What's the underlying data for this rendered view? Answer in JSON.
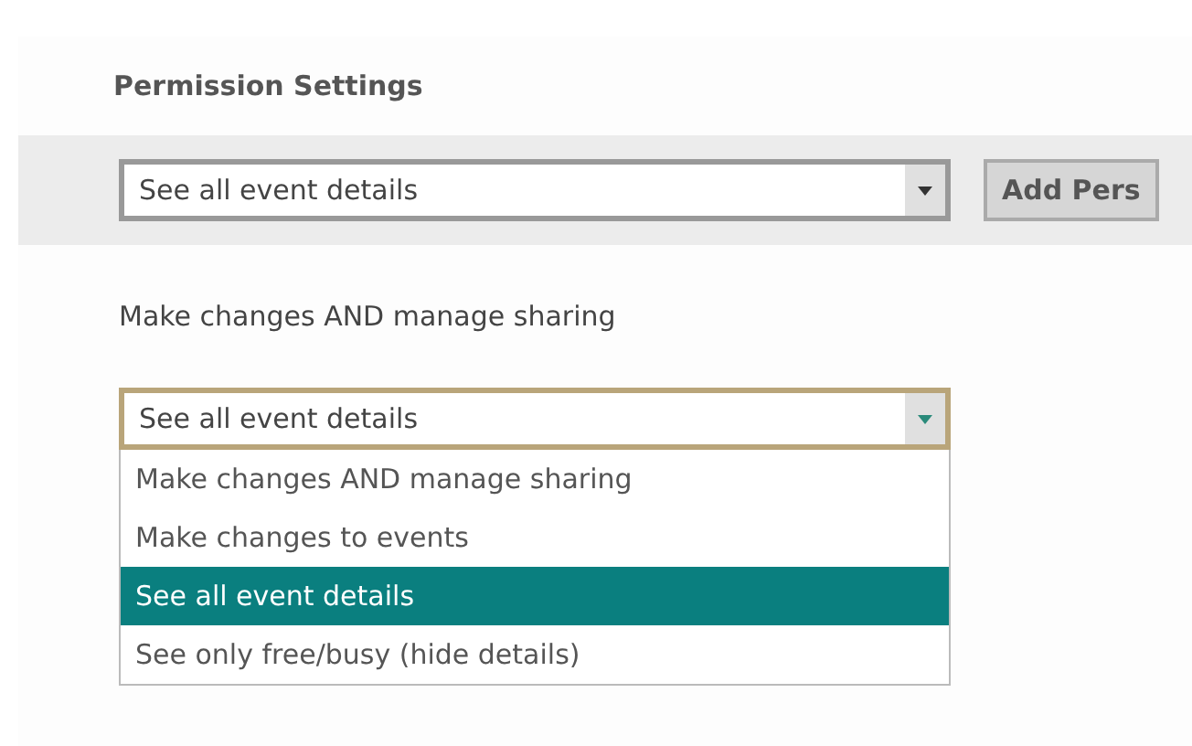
{
  "heading": "Permission Settings",
  "permission_row": {
    "select_value": "See all event details",
    "button": "Add Pers"
  },
  "current_permission": "Make changes AND manage sharing",
  "dropdown": {
    "value": "See all event details",
    "expanded": true,
    "options": [
      {
        "label": "Make changes AND manage sharing",
        "selected": false
      },
      {
        "label": "Make changes to events",
        "selected": false
      },
      {
        "label": "See all event details",
        "selected": true
      },
      {
        "label": "See only free/busy (hide details)",
        "selected": false
      }
    ]
  }
}
